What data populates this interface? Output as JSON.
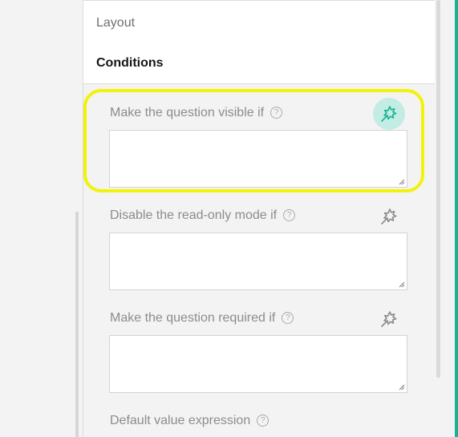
{
  "sections": {
    "layout_label": "Layout",
    "conditions_label": "Conditions"
  },
  "conditions": {
    "fields": [
      {
        "label": "Make the question visible if",
        "value": "",
        "wand_active": true
      },
      {
        "label": "Disable the read-only mode if",
        "value": ""
      },
      {
        "label": "Make the question required if",
        "value": ""
      },
      {
        "label": "Default value expression"
      }
    ],
    "help_glyph": "?",
    "wand_icon": "magic-wand-icon",
    "help_icon": "help-circle-icon"
  },
  "colors": {
    "accent": "#19b394",
    "highlight": "#f2f20a",
    "wand_active_bg": "#c2ece4"
  }
}
